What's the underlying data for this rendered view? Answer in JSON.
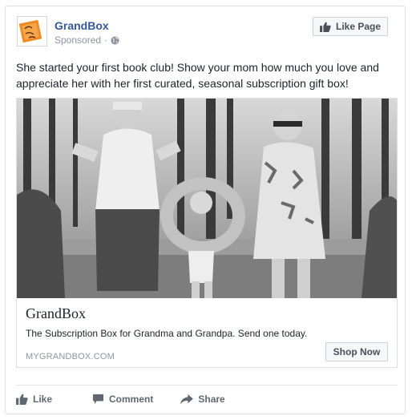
{
  "post": {
    "page_name": "GrandBox",
    "sponsored_label": "Sponsored",
    "dot": "·",
    "like_page_label": "Like Page",
    "body_text": "She started your first book club! Show your mom how much you love and appreciate her with her first curated, seasonal subscription gift box!"
  },
  "link": {
    "title": "GrandBox",
    "description": "The Subscription Box for Grandma and Grandpa. Send one today.",
    "domain": "MYGRANDBOX.COM",
    "cta_label": "Shop Now"
  },
  "actions": {
    "like_label": "Like",
    "comment_label": "Comment",
    "share_label": "Share"
  },
  "colors": {
    "page_name": "#365899",
    "muted": "#90949c",
    "button_bg": "#f6f7f9",
    "logo_orange": "#f08a24"
  },
  "icons": [
    "grandbox-logo-icon",
    "globe-icon",
    "thumbs-up-icon",
    "comment-icon",
    "share-icon"
  ]
}
